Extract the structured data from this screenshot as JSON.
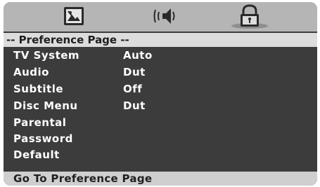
{
  "tabs": [
    {
      "icon": "picture-settings-icon"
    },
    {
      "icon": "audio-speaker-icon"
    },
    {
      "icon": "lock-icon",
      "selected": true
    }
  ],
  "page_title": "-- Preference Page --",
  "menu": [
    {
      "label": "TV System",
      "value": "Auto"
    },
    {
      "label": "Audio",
      "value": "Dut"
    },
    {
      "label": "Subtitle",
      "value": "Off"
    },
    {
      "label": "Disc Menu",
      "value": "Dut"
    },
    {
      "label": "Parental",
      "value": ""
    },
    {
      "label": "Password",
      "value": ""
    },
    {
      "label": "Default",
      "value": ""
    }
  ],
  "status_text": "Go To Preference Page",
  "colors": {
    "frame": "#3c3c3c",
    "top_bar": "#b5b5b5",
    "header_bar": "#dcdcdc",
    "footer_bar": "#cfcfcf",
    "text": "#ffffff"
  }
}
